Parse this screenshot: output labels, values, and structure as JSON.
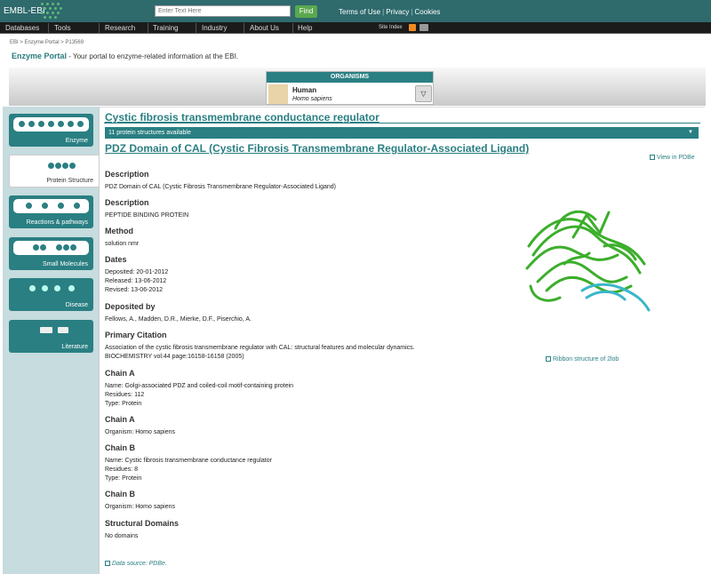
{
  "header": {
    "logo_text": "EMBL-EBI",
    "search_placeholder": "Enter Text Here",
    "find_label": "Find",
    "links": [
      "Terms of Use",
      "Privacy",
      "Cookies"
    ]
  },
  "nav": {
    "items": [
      "Databases",
      "Tools",
      "Research",
      "Training",
      "Industry",
      "About Us",
      "Help"
    ],
    "site_index": "Site Index"
  },
  "breadcrumb": "EBI > Enzyme Portal > P13569",
  "portal": {
    "title": "Enzyme Portal",
    "tagline": " - Your portal to enzyme-related information at the EBI."
  },
  "organisms": {
    "heading": "ORGANISMS",
    "name": "Human",
    "scientific": "Homo sapiens"
  },
  "sidebar": {
    "items": [
      {
        "label": "Enzyme",
        "icon": "enzyme-icon"
      },
      {
        "label": "Protein Structure",
        "icon": "protein-structure-icon"
      },
      {
        "label": "Reactions & pathways",
        "icon": "reactions-icon"
      },
      {
        "label": "Small Molecules",
        "icon": "small-molecules-icon"
      },
      {
        "label": "Disease",
        "icon": "disease-icon"
      },
      {
        "label": "Literature",
        "icon": "literature-icon"
      }
    ],
    "active": "Protein Structure"
  },
  "main": {
    "title": "Cystic fibrosis transmembrane conductance regulator",
    "structures_select": "11 protein structures available",
    "structure_title": "PDZ Domain of CAL (Cystic Fibrosis Transmembrane Regulator-Associated Ligand)",
    "view_pdbe": "View in PDBe",
    "ribbon_link": "Ribbon structure of 2lob",
    "data_source": "Data source: PDBe.",
    "sections": [
      {
        "heading": "Description",
        "lines": [
          "PDZ Domain of CAL (Cystic Fibrosis Transmembrane Regulator-Associated Ligand)"
        ]
      },
      {
        "heading": "Description",
        "lines": [
          "PEPTIDE BINDING PROTEIN"
        ]
      },
      {
        "heading": "Method",
        "lines": [
          "solution nmr"
        ]
      },
      {
        "heading": "Dates",
        "lines": [
          "Deposited: 20-01-2012",
          "Released: 13-06-2012",
          "Revised: 13-06-2012"
        ]
      },
      {
        "heading": "Deposited by",
        "lines": [
          "Fellows, A., Madden, D.R., Mierke, D.F., Piserchio, A."
        ]
      },
      {
        "heading": "Primary Citation",
        "lines": [
          "Association of the cystic fibrosis transmembrane regulator with CAL: structural features and molecular dynamics.",
          "BIOCHEMISTRY vol:44 page:16158-16158 (2005)"
        ]
      },
      {
        "heading": "Chain A",
        "lines": [
          "Name: Golgi-associated PDZ and coiled-coil motif-containing protein",
          "Residues: 112",
          "Type: Protein"
        ]
      },
      {
        "heading": "Chain A",
        "lines": [
          "Organism: Homo sapiens"
        ]
      },
      {
        "heading": "Chain B",
        "lines": [
          "Name: Cystic fibrosis transmembrane conductance regulator",
          "Residues: 8",
          "Type: Protein"
        ]
      },
      {
        "heading": "Chain B",
        "lines": [
          "Organism: Homo sapiens"
        ]
      },
      {
        "heading": "Structural Domains",
        "lines": [
          "No domains"
        ]
      }
    ]
  },
  "colors": {
    "teal": "#2a7f82",
    "topbar": "#2f6a6d",
    "protein_green": "#3cae2c",
    "protein_cyan": "#3bb6c9"
  }
}
